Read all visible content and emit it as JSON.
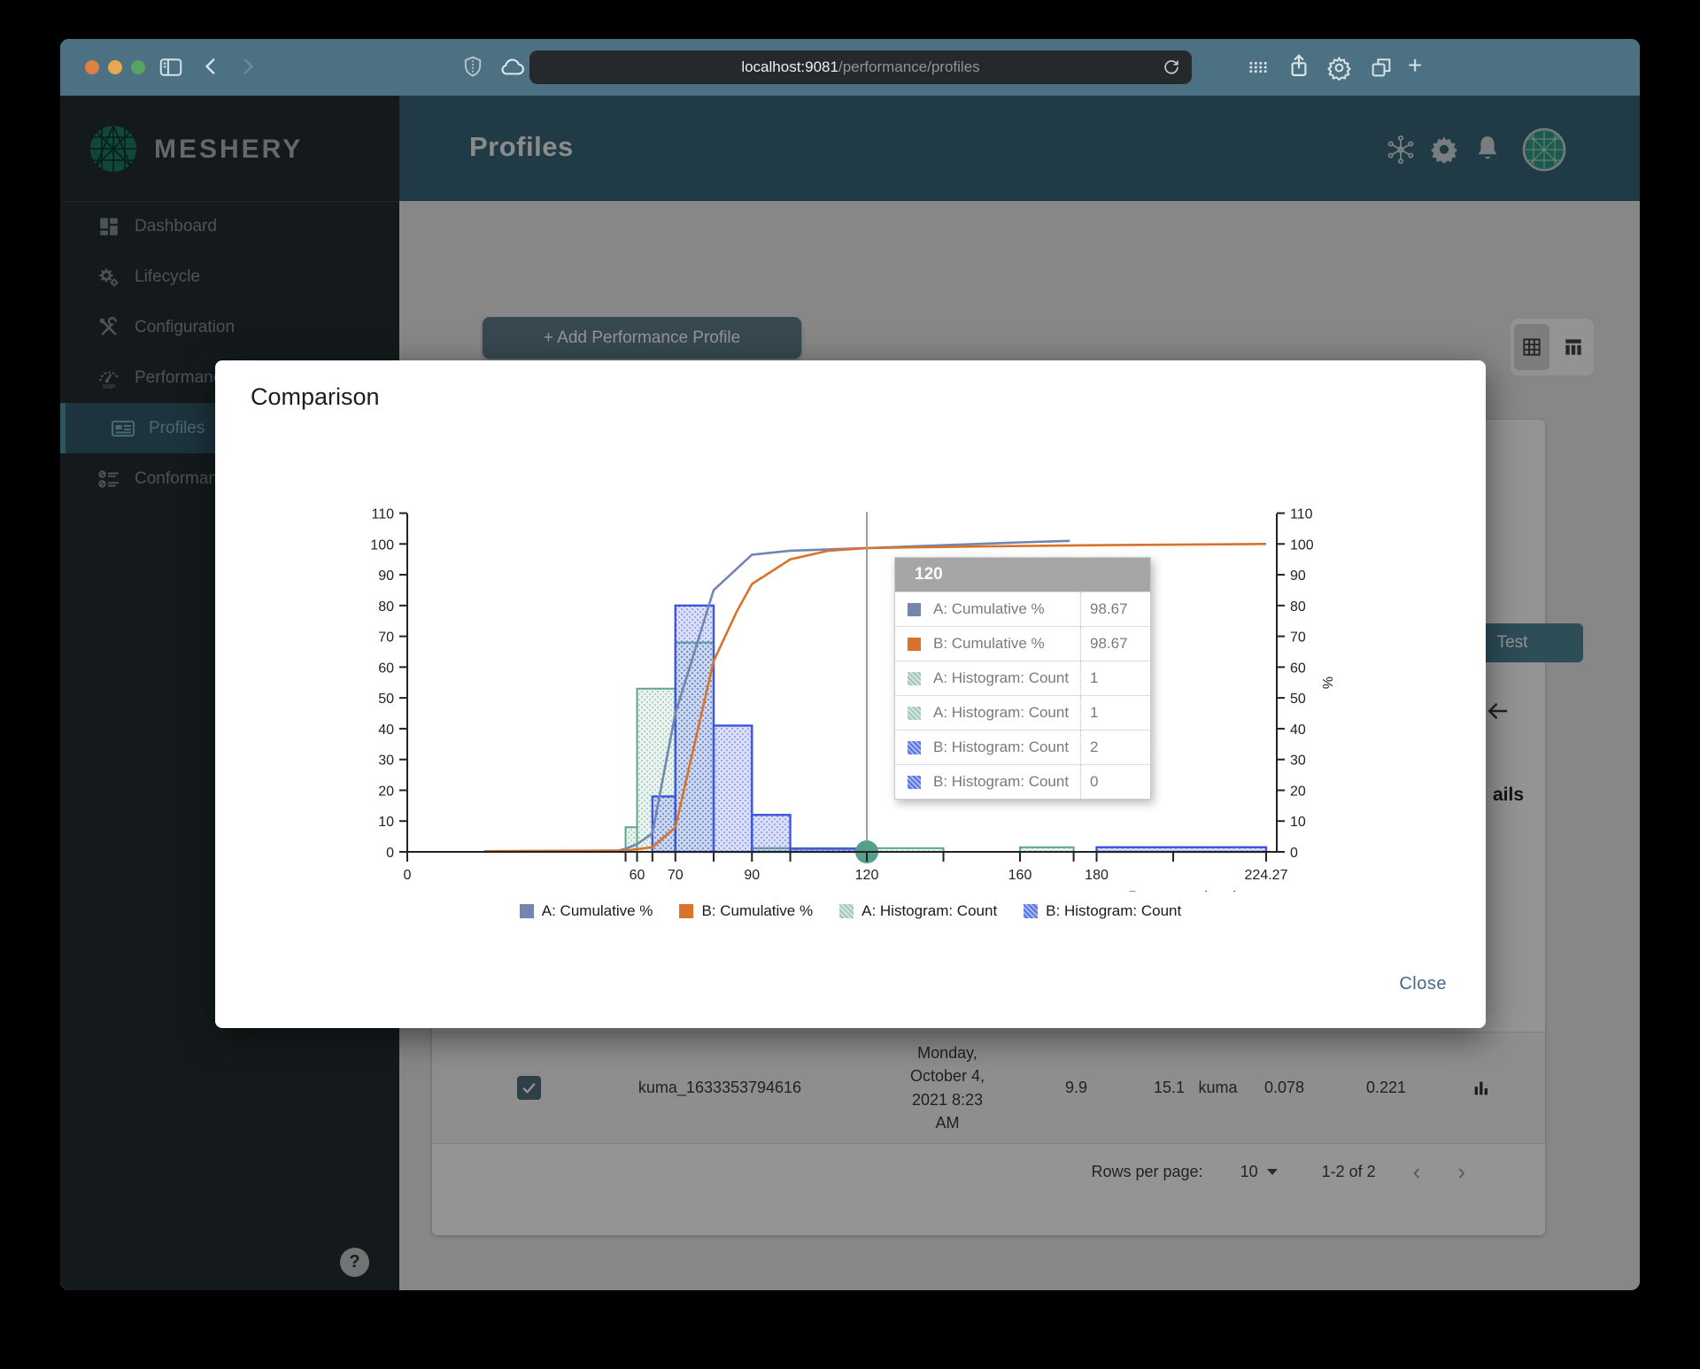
{
  "browser": {
    "url_host": "localhost:9081",
    "url_path": "/performance/profiles",
    "chrome_icons": [
      "sidebar-toggle-icon",
      "back-icon",
      "forward-icon",
      "shield-icon",
      "cloud-icon",
      "reload-icon",
      "grid-dots-icon",
      "share-icon",
      "settings-icon",
      "tab-overview-icon",
      "new-tab-icon"
    ]
  },
  "app": {
    "brand": "MESHERY",
    "page_title": "Profiles",
    "header_icons": [
      "mesh-sync-icon",
      "settings-gear-icon",
      "notification-bell-icon",
      "user-avatar"
    ],
    "sidebar": {
      "items": [
        {
          "label": "Dashboard",
          "icon": "dashboard-icon",
          "active": false
        },
        {
          "label": "Lifecycle",
          "icon": "lifecycle-icon",
          "active": false
        },
        {
          "label": "Configuration",
          "icon": "configuration-icon",
          "active": false
        },
        {
          "label": "Performance",
          "icon": "performance-smp-icon",
          "active": false
        },
        {
          "label": "Profiles",
          "icon": "profiles-icon",
          "active": true
        },
        {
          "label": "Conformance",
          "icon": "conformance-icon",
          "active": false
        }
      ]
    }
  },
  "content": {
    "add_button_label": "+ Add Performance Profile",
    "test_button_label": "Test",
    "details_fragment": "ails",
    "table_row": {
      "name": "kuma_1633353794616",
      "mesh": "kuma",
      "date": "Monday, October 4, 2021 8:23 AM",
      "values": [
        "9.9",
        "15.1",
        "0.078",
        "0.221"
      ]
    },
    "pagination": {
      "label": "Rows per page:",
      "value": "10",
      "range": "1-2 of 2"
    }
  },
  "modal": {
    "title": "Comparison",
    "close_label": "Close"
  },
  "colors": {
    "accent_teal": "#4f97a5",
    "series_a_line": "#7286b2",
    "series_b_line": "#d9732c",
    "series_a_hist": "#5fa886",
    "series_b_hist": "#3f55e0",
    "hover_dot": "#55a08b"
  },
  "chart_data": {
    "type": "combo-histogram-cumulative",
    "xlabel": "Response time in ms",
    "ylabel_right": "%",
    "xlim": [
      0,
      224.27
    ],
    "ylim": [
      0,
      110
    ],
    "grid": false,
    "legend_position": "bottom",
    "y_ticks": [
      0,
      10,
      20,
      30,
      40,
      50,
      60,
      70,
      80,
      90,
      100,
      110
    ],
    "x_ticks_labeled": [
      0,
      60,
      70,
      90,
      120,
      160,
      180,
      224.27
    ],
    "x_tick_labels": [
      "0",
      "60",
      "70",
      "90",
      "120",
      "160",
      "180",
      "224.27"
    ],
    "x_ticks_minor": [
      57,
      64,
      80,
      100,
      140,
      174,
      200
    ],
    "series": [
      {
        "name": "A: Cumulative %",
        "type": "line",
        "color": "#7286b2",
        "points": [
          [
            20,
            0.2
          ],
          [
            55,
            0.4
          ],
          [
            57,
            1
          ],
          [
            60,
            2.5
          ],
          [
            64,
            6
          ],
          [
            70,
            45
          ],
          [
            80,
            85
          ],
          [
            90,
            96.5
          ],
          [
            100,
            97.8
          ],
          [
            120,
            98.67
          ],
          [
            140,
            99.6
          ],
          [
            160,
            100.5
          ],
          [
            173,
            101
          ]
        ]
      },
      {
        "name": "B: Cumulative %",
        "type": "line",
        "color": "#d9732c",
        "points": [
          [
            20,
            0.2
          ],
          [
            57,
            0.4
          ],
          [
            64,
            1.5
          ],
          [
            70,
            8
          ],
          [
            80,
            62
          ],
          [
            86,
            78
          ],
          [
            90,
            87
          ],
          [
            100,
            95
          ],
          [
            110,
            97.8
          ],
          [
            120,
            98.67
          ],
          [
            150,
            99.2
          ],
          [
            180,
            99.6
          ],
          [
            224.27,
            100
          ]
        ]
      },
      {
        "name": "A: Histogram: Count",
        "type": "bar",
        "color": "#5fa886",
        "bars": [
          [
            57,
            60,
            8
          ],
          [
            60,
            70,
            53
          ],
          [
            70,
            80,
            68
          ],
          [
            90,
            120,
            1.2
          ],
          [
            120,
            140,
            1.2
          ],
          [
            160,
            174,
            1.5
          ]
        ]
      },
      {
        "name": "B: Histogram: Count",
        "type": "bar",
        "color": "#3f55e0",
        "bars": [
          [
            64,
            70,
            18
          ],
          [
            70,
            80,
            80
          ],
          [
            80,
            90,
            41
          ],
          [
            90,
            100,
            12
          ],
          [
            100,
            120,
            1
          ],
          [
            180,
            224.27,
            1.5
          ]
        ]
      }
    ],
    "legend": [
      {
        "label": "A: Cumulative %",
        "marker": "solid",
        "color": "#7486ad"
      },
      {
        "label": "B: Cumulative %",
        "marker": "solid",
        "color": "#d9732c"
      },
      {
        "label": "A: Histogram: Count",
        "marker": "pattern-teal"
      },
      {
        "label": "B: Histogram: Count",
        "marker": "pattern-blue"
      }
    ],
    "hover": {
      "x": 120,
      "tooltip": {
        "title": "120",
        "rows": [
          {
            "swatch": "solid",
            "color": "#7486ad",
            "label": "A: Cumulative %",
            "value": "98.67"
          },
          {
            "swatch": "solid",
            "color": "#d9732c",
            "label": "B: Cumulative %",
            "value": "98.67"
          },
          {
            "swatch": "pattern-teal",
            "label": "A: Histogram: Count",
            "value": "1"
          },
          {
            "swatch": "pattern-teal",
            "label": "A: Histogram: Count",
            "value": "1"
          },
          {
            "swatch": "pattern-blue",
            "label": "B: Histogram: Count",
            "value": "2"
          },
          {
            "swatch": "pattern-blue",
            "label": "B: Histogram: Count",
            "value": "0"
          }
        ]
      }
    }
  }
}
